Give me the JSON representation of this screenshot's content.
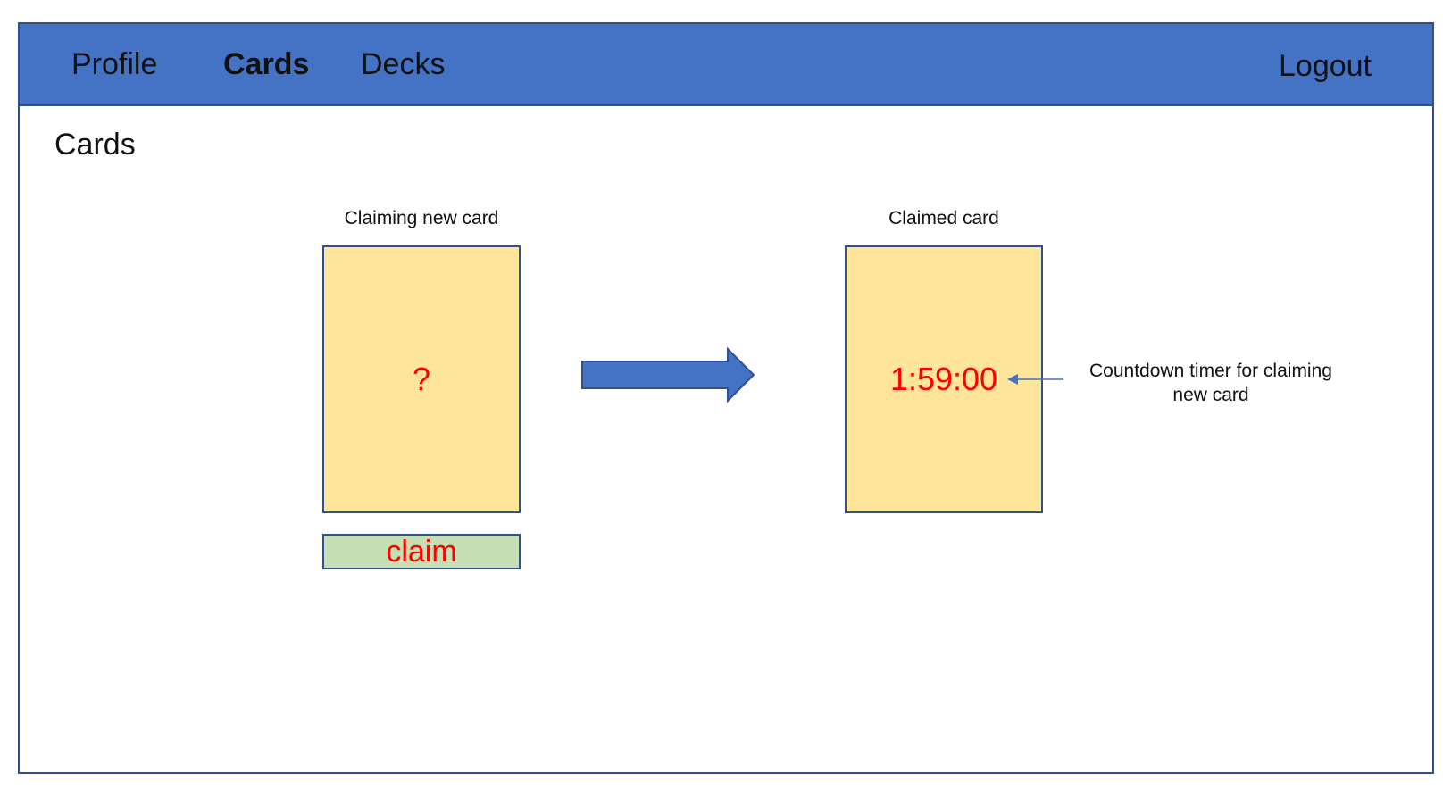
{
  "nav": {
    "items": [
      {
        "label": "Profile",
        "active": false
      },
      {
        "label": "Cards",
        "active": true
      },
      {
        "label": "Decks",
        "active": false
      }
    ],
    "logout_label": "Logout"
  },
  "page": {
    "title": "Cards"
  },
  "claiming_card": {
    "caption": "Claiming new card",
    "content": "?",
    "button_label": "claim"
  },
  "claimed_card": {
    "caption": "Claimed card",
    "timer": "1:59:00"
  },
  "annotation": {
    "text": "Countdown timer for claiming new card"
  },
  "icons": {
    "transition": "right-arrow-icon",
    "annotation_pointer": "left-arrow-icon"
  },
  "colors": {
    "nav_background": "#4472c4",
    "border": "#2f528f",
    "card_background": "#ffe599",
    "button_background": "#c5e0b4",
    "accent_text": "#ff0000"
  }
}
